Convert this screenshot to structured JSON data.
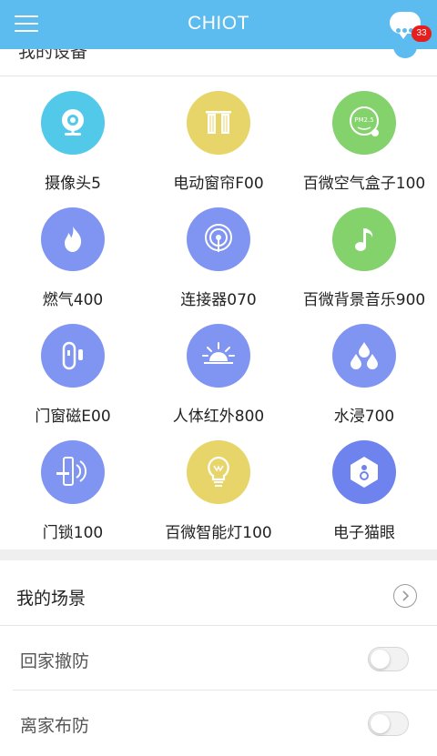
{
  "header": {
    "title": "CHIOT",
    "menu_icon": "hamburger-menu-icon",
    "message_icon": "chat-bubble-icon",
    "badge_count": "33",
    "background": "#5cbcf0"
  },
  "devices_section": {
    "title": "我的设备"
  },
  "devices": [
    {
      "label": "摄像头5",
      "icon": "camera-icon",
      "color": "#52c9e8"
    },
    {
      "label": "电动窗帘F00",
      "icon": "curtain-icon",
      "color": "#e8d56a"
    },
    {
      "label": "百微空气盒子100",
      "icon": "air-box-icon",
      "color": "#84d26c"
    },
    {
      "label": "燃气400",
      "icon": "flame-icon",
      "color": "#7f95f1"
    },
    {
      "label": "连接器070",
      "icon": "broadcast-icon",
      "color": "#7f95f1"
    },
    {
      "label": "百微背景音乐900",
      "icon": "music-note-icon",
      "color": "#84d26c"
    },
    {
      "label": "门窗磁E00",
      "icon": "door-sensor-icon",
      "color": "#7f95f1"
    },
    {
      "label": "人体红外800",
      "icon": "sunrise-icon",
      "color": "#7f95f1"
    },
    {
      "label": "水浸700",
      "icon": "water-drops-icon",
      "color": "#7f95f1"
    },
    {
      "label": "门锁100",
      "icon": "door-lock-icon",
      "color": "#7f95f1"
    },
    {
      "label": "百微智能灯100",
      "icon": "light-bulb-icon",
      "color": "#e8d56a"
    },
    {
      "label": "电子猫眼",
      "icon": "peephole-icon",
      "color": "#7f95f1"
    }
  ],
  "scenes": {
    "title": "我的场景",
    "items": [
      {
        "label": "回家撤防",
        "enabled": false
      },
      {
        "label": "离家布防",
        "enabled": false
      }
    ]
  }
}
